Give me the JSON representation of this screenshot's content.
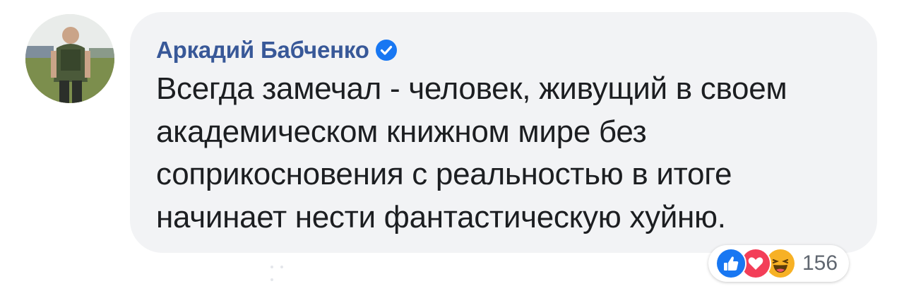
{
  "comment": {
    "author": "Аркадий Бабченко",
    "text": "Всегда замечал - человек, живущий в своем академическом книжном мире без соприкосновения с реальностью в итоге начинает нести фантастическую хуйню.",
    "verified": true
  },
  "reactions": {
    "icons": [
      "like-icon",
      "love-icon",
      "haha-icon"
    ],
    "count": "156"
  },
  "colors": {
    "author": "#385898",
    "bubble": "#f2f3f5",
    "verified": "#1877f2",
    "like": "#1877f2",
    "love": "#f33e58",
    "haha": "#f7b125"
  }
}
